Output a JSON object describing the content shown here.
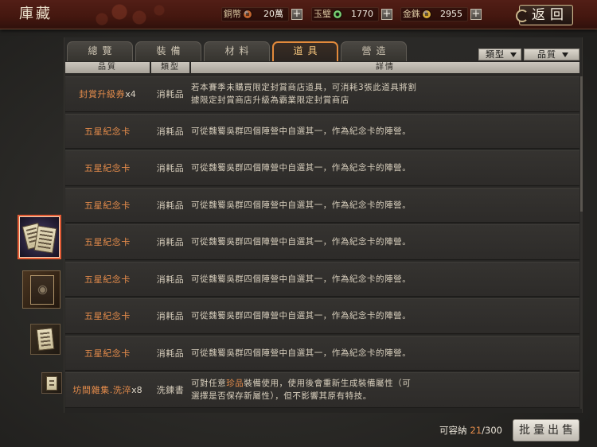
{
  "header": {
    "title": "庫藏",
    "back_label": "返回",
    "add_symbol": "+",
    "currencies": [
      {
        "label": "銅幣",
        "value": "20萬",
        "icon": "copper-coin-icon",
        "color": "#c2642f"
      },
      {
        "label": "玉璧",
        "value": "1770",
        "icon": "jade-disc-icon",
        "color": "#4fae4a"
      },
      {
        "label": "金銖",
        "value": "2955",
        "icon": "gold-coin-icon",
        "color": "#d6a93a"
      }
    ]
  },
  "tabs": [
    {
      "label": "總覽",
      "active": false
    },
    {
      "label": "裝備",
      "active": false
    },
    {
      "label": "材料",
      "active": false
    },
    {
      "label": "道具",
      "active": true
    },
    {
      "label": "營造",
      "active": false
    }
  ],
  "filters": [
    {
      "label": "類型",
      "icon": "chevron-down-icon"
    },
    {
      "label": "品質",
      "icon": "chevron-down-icon"
    }
  ],
  "columns": {
    "quality": "品質",
    "type": "類型",
    "detail": "詳情"
  },
  "items": [
    {
      "name": "封賞升級券",
      "count": "x4",
      "type": "消耗品",
      "detail": [
        [
          {
            "text": "若本賽季未購買限定封賞商店道具，可消耗3張此道具將割"
          }
        ],
        [
          {
            "text": "據限定封賞商店升級為霸業限定封賞商店"
          }
        ]
      ]
    },
    {
      "name": "五星紀念卡",
      "type": "消耗品",
      "detail": [
        [
          {
            "text": "可從魏蜀吳群四個陣營中自選其一，作為紀念卡的陣營。"
          }
        ]
      ]
    },
    {
      "name": "五星紀念卡",
      "type": "消耗品",
      "detail": [
        [
          {
            "text": "可從魏蜀吳群四個陣營中自選其一，作為紀念卡的陣營。"
          }
        ]
      ]
    },
    {
      "name": "五星紀念卡",
      "type": "消耗品",
      "detail": [
        [
          {
            "text": "可從魏蜀吳群四個陣營中自選其一，作為紀念卡的陣營。"
          }
        ]
      ]
    },
    {
      "name": "五星紀念卡",
      "type": "消耗品",
      "detail": [
        [
          {
            "text": "可從魏蜀吳群四個陣營中自選其一，作為紀念卡的陣營。"
          }
        ]
      ]
    },
    {
      "name": "五星紀念卡",
      "type": "消耗品",
      "detail": [
        [
          {
            "text": "可從魏蜀吳群四個陣營中自選其一，作為紀念卡的陣營。"
          }
        ]
      ]
    },
    {
      "name": "五星紀念卡",
      "type": "消耗品",
      "detail": [
        [
          {
            "text": "可從魏蜀吳群四個陣營中自選其一，作為紀念卡的陣營。"
          }
        ]
      ]
    },
    {
      "name": "五星紀念卡",
      "type": "消耗品",
      "detail": [
        [
          {
            "text": "可從魏蜀吳群四個陣營中自選其一，作為紀念卡的陣營。"
          }
        ]
      ]
    },
    {
      "name": "坊間雜集.洗淬",
      "count": "x8",
      "type": "洗鍊書",
      "detail": [
        [
          {
            "text": "可對任意"
          },
          {
            "text": "珍品",
            "highlight": true
          },
          {
            "text": "裝備使用，使用後會重新生成裝備屬性（可"
          }
        ],
        [
          {
            "text": "選擇是否保存新屬性），但不影響其原有特技。"
          }
        ]
      ]
    }
  ],
  "thumbnails": [
    {
      "icon": "card-stack-icon",
      "selected": true
    },
    {
      "icon": "emblem-card-icon",
      "selected": false
    },
    {
      "icon": "scroll-card-icon",
      "selected": false
    },
    {
      "icon": "scroll-card-icon",
      "selected": false
    }
  ],
  "capacity": {
    "label": "可容納",
    "used": "21",
    "sep": "/",
    "max": "300"
  },
  "bulk_sell_label": "批量出售",
  "colors": {
    "accent": "#e38a3b",
    "item_name": "#e58c4b",
    "selected_border": "#e35b35"
  }
}
